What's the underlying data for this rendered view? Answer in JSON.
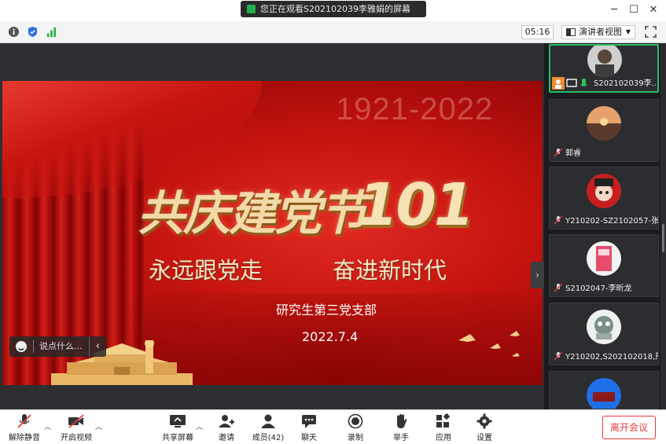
{
  "title_bar": {
    "sharing_text": "您正在观看S202102039李雅娟的屏幕",
    "controls": [
      "minimize",
      "maximize",
      "close"
    ]
  },
  "toolbar": {
    "timer": "05:16",
    "view_mode": "演讲者视图"
  },
  "slide": {
    "years": "1921-2022",
    "headline": "共庆建党节",
    "headline_number": "101",
    "subtitle_left": "永远跟党走",
    "subtitle_right": "奋进新时代",
    "branch": "研究生第三党支部",
    "date": "2022.7.4"
  },
  "comment": {
    "placeholder": "说点什么..."
  },
  "participants": [
    {
      "name": "S202102039李...",
      "active": true
    },
    {
      "name": "郭睿"
    },
    {
      "name": "Y210202-SZ2102057-张..."
    },
    {
      "name": "S2102047-李昕龙"
    },
    {
      "name": "Y210202,S202102018,邢..."
    },
    {
      "name": ""
    }
  ],
  "bottom_bar": {
    "unmute": "解除静音",
    "start_video": "开启视频",
    "share_screen": "共享屏幕",
    "invite": "邀请",
    "members": "成员(42)",
    "chat": "聊天",
    "record": "录制",
    "raise_hand": "举手",
    "apps": "应用",
    "settings": "设置",
    "leave": "离开会议"
  },
  "colors": {
    "accent_green": "#26c06a",
    "leave_red": "#e23b3b",
    "slide_red": "#c5140f"
  }
}
